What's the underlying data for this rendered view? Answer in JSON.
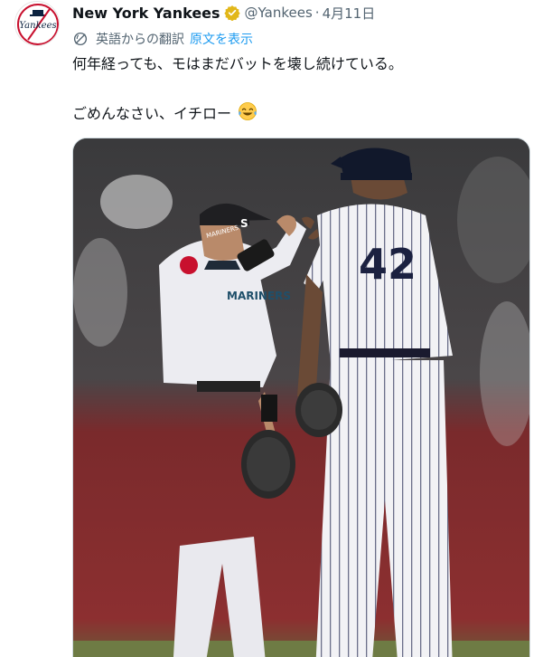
{
  "tweet": {
    "author_name": "New York Yankees",
    "handle": "@Yankees",
    "separator": "·",
    "date": "4月11日",
    "verified_icon": "verified-badge-icon",
    "avatar_text": "Yankees",
    "translation": {
      "label": "英語からの翻訳",
      "show_original": "原文を表示",
      "icon": "translate-globe-icon"
    },
    "text_line1": "何年経っても、モはまだバットを壊し続けている。",
    "text_line2": "ごめんなさい、イチロー",
    "emoji": "face-with-tears-of-joy-icon",
    "photo": {
      "left_cap_letter": "S",
      "left_jersey_text": "MARINERS",
      "left_collar_text": "MARINERS",
      "right_number": "42"
    }
  },
  "colors": {
    "link": "#1d9bf0",
    "secondary_text": "#536471",
    "verified_gold": "#e2b719",
    "yankees_red": "#c8102e",
    "yankees_navy": "#0c2340"
  }
}
